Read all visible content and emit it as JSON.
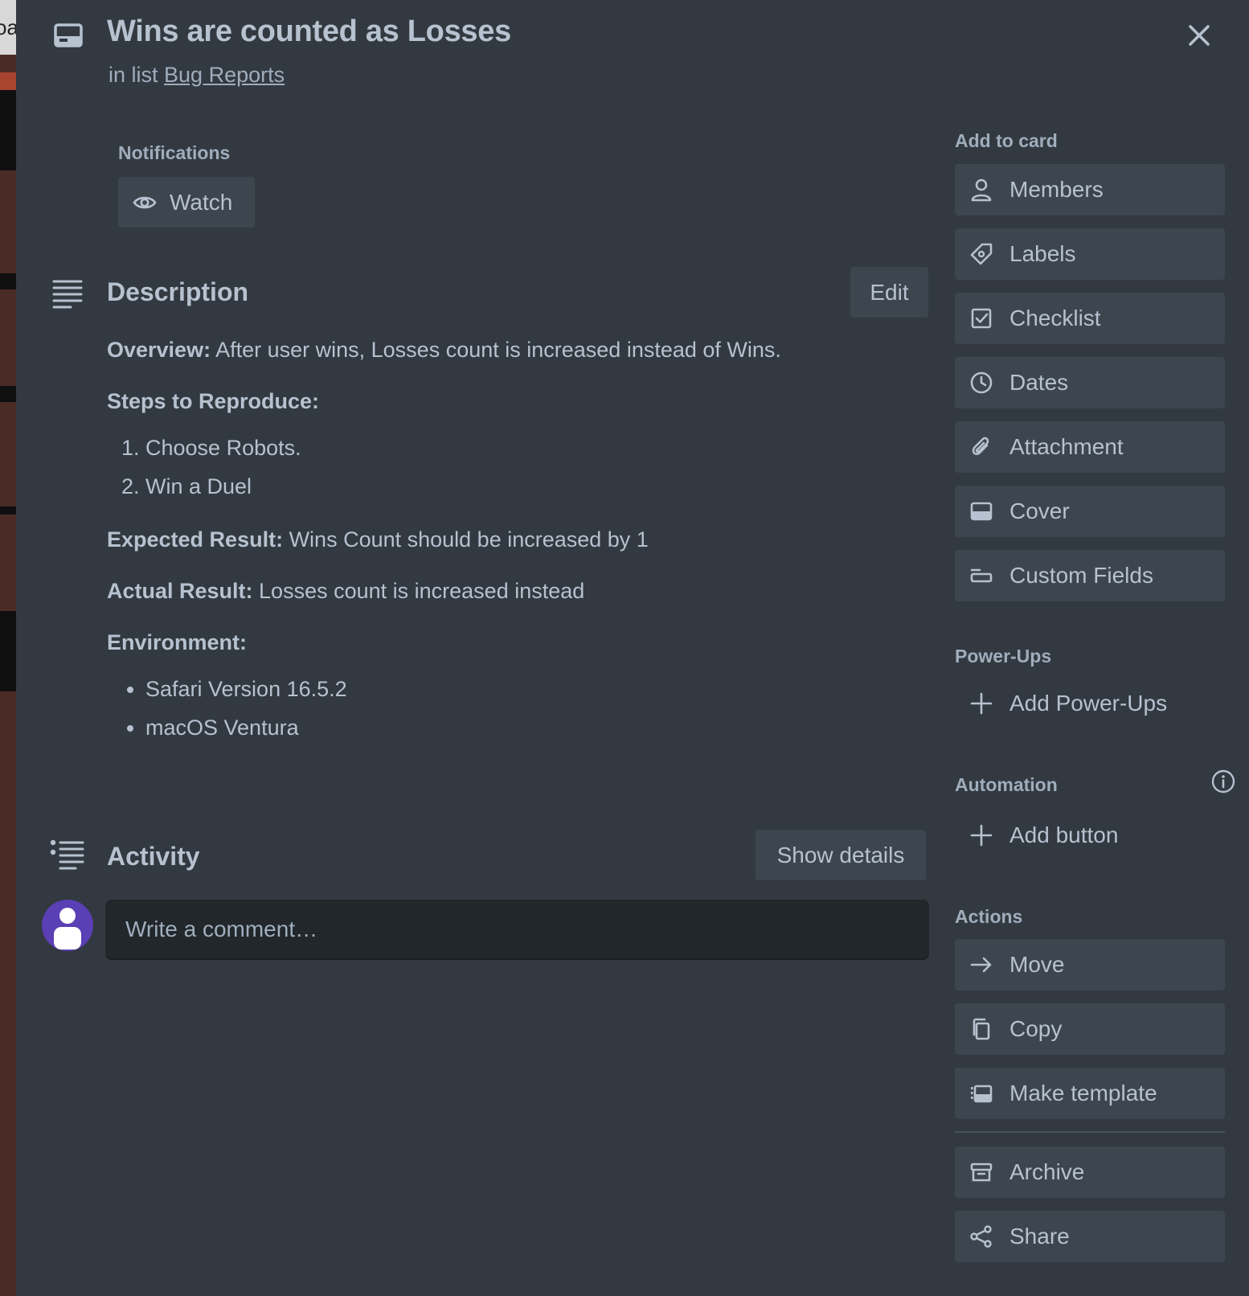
{
  "board": {
    "tab_fragment": "oa"
  },
  "card": {
    "title": "Wins are counted as Losses",
    "list_prefix": "in list",
    "list_name": "Bug Reports"
  },
  "notifications": {
    "label": "Notifications",
    "watch_label": "Watch"
  },
  "description": {
    "heading": "Description",
    "edit_label": "Edit",
    "overview_label": "Overview:",
    "overview_text": " After user wins, Losses count is increased instead of Wins.",
    "steps_label": "Steps to Reproduce:",
    "steps": [
      "Choose Robots.",
      "Win a Duel"
    ],
    "expected_label": "Expected Result:",
    "expected_text": " Wins Count should be increased by 1",
    "actual_label": "Actual Result:",
    "actual_text": " Losses count is increased instead",
    "environment_label": "Environment:",
    "environment": [
      "Safari Version 16.5.2",
      "macOS Ventura"
    ]
  },
  "activity": {
    "heading": "Activity",
    "show_details_label": "Show details",
    "comment_placeholder": "Write a comment…"
  },
  "sidebar": {
    "add_to_card_label": "Add to card",
    "add_to_card": [
      {
        "label": "Members",
        "icon": "person-icon"
      },
      {
        "label": "Labels",
        "icon": "tag-icon"
      },
      {
        "label": "Checklist",
        "icon": "checkbox-icon"
      },
      {
        "label": "Dates",
        "icon": "clock-icon"
      },
      {
        "label": "Attachment",
        "icon": "paperclip-icon"
      },
      {
        "label": "Cover",
        "icon": "cover-icon"
      },
      {
        "label": "Custom Fields",
        "icon": "fields-icon"
      }
    ],
    "powerups_label": "Power-Ups",
    "add_powerups_label": "Add Power-Ups",
    "automation_label": "Automation",
    "add_button_label": "Add button",
    "actions_label": "Actions",
    "actions": [
      {
        "label": "Move",
        "icon": "arrow-right-icon"
      },
      {
        "label": "Copy",
        "icon": "copy-icon"
      },
      {
        "label": "Make template",
        "icon": "template-icon"
      },
      {
        "label": "Archive",
        "icon": "archive-icon"
      },
      {
        "label": "Share",
        "icon": "share-icon"
      }
    ]
  },
  "colors": {
    "modal_bg": "#323940",
    "button_bg": "#3d454e",
    "text": "#b6c2cf",
    "muted_text": "#9fadbc",
    "avatar_bg": "#5b3fb4"
  }
}
